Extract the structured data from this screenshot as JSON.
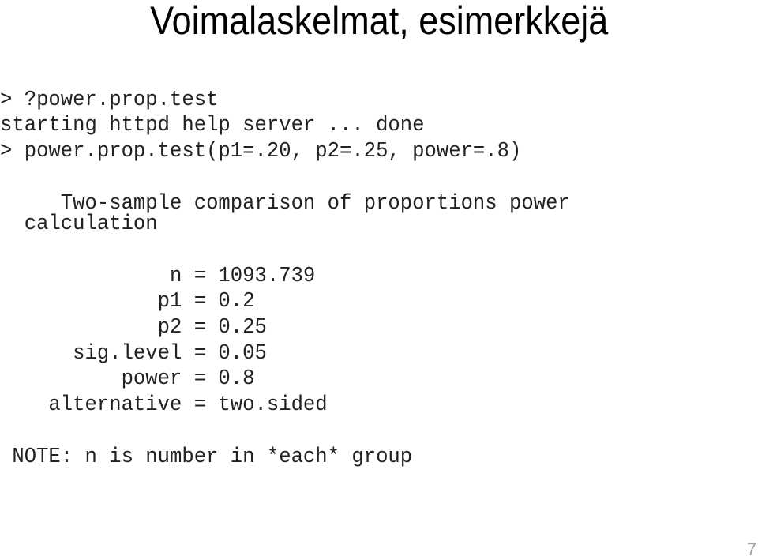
{
  "slide": {
    "title": "Voimalaskelmat, esimerkkejä",
    "page_number": "7"
  },
  "console": {
    "lines": [
      "> ?power.prop.test",
      "starting httpd help server ... done",
      "> power.prop.test(p1=.20, p2=.25, power=.8)"
    ],
    "heading_line1": "     Two-sample comparison of proportions power",
    "heading_line2": "  calculation",
    "results": [
      "              n = 1093.739",
      "             p1 = 0.2",
      "             p2 = 0.25",
      "      sig.level = 0.05",
      "          power = 0.8",
      "    alternative = two.sided"
    ],
    "note": " NOTE: n is number in *each* group"
  }
}
